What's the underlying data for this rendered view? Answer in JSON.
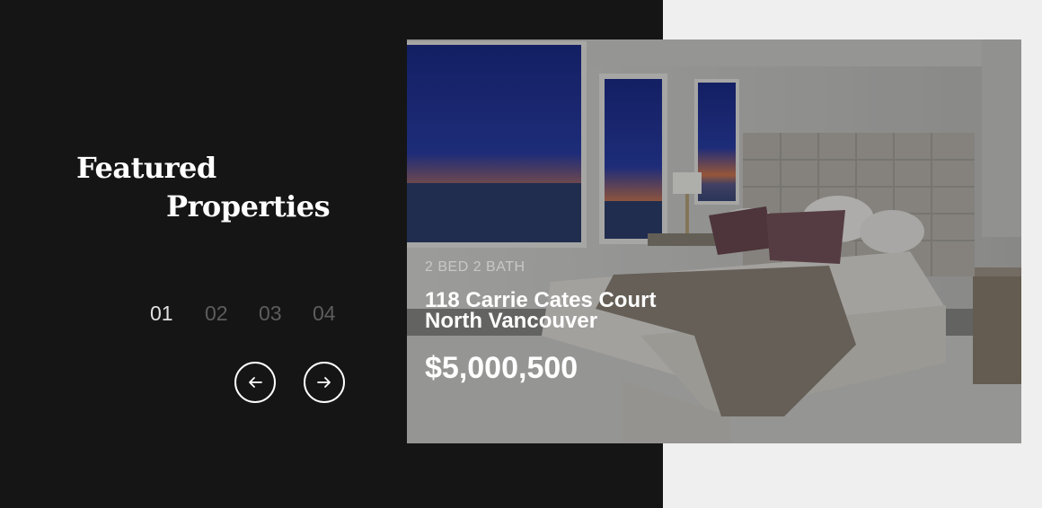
{
  "heading": {
    "line1": "Featured",
    "line2": "Properties"
  },
  "pager": {
    "items": [
      "01",
      "02",
      "03",
      "04"
    ],
    "active": "01"
  },
  "nav": {
    "prev_icon": "arrow-left-icon",
    "next_icon": "arrow-right-icon"
  },
  "property": {
    "beds_baths": "2 BED 2 BATH",
    "address_line1": "118 Carrie Cates Court",
    "address_line2": "North Vancouver",
    "price": "$5,000,500"
  },
  "colors": {
    "dark_panel": "#151515",
    "light_bg": "#efefef",
    "text": "#ffffff",
    "inactive_page": "#5d5d5d"
  }
}
